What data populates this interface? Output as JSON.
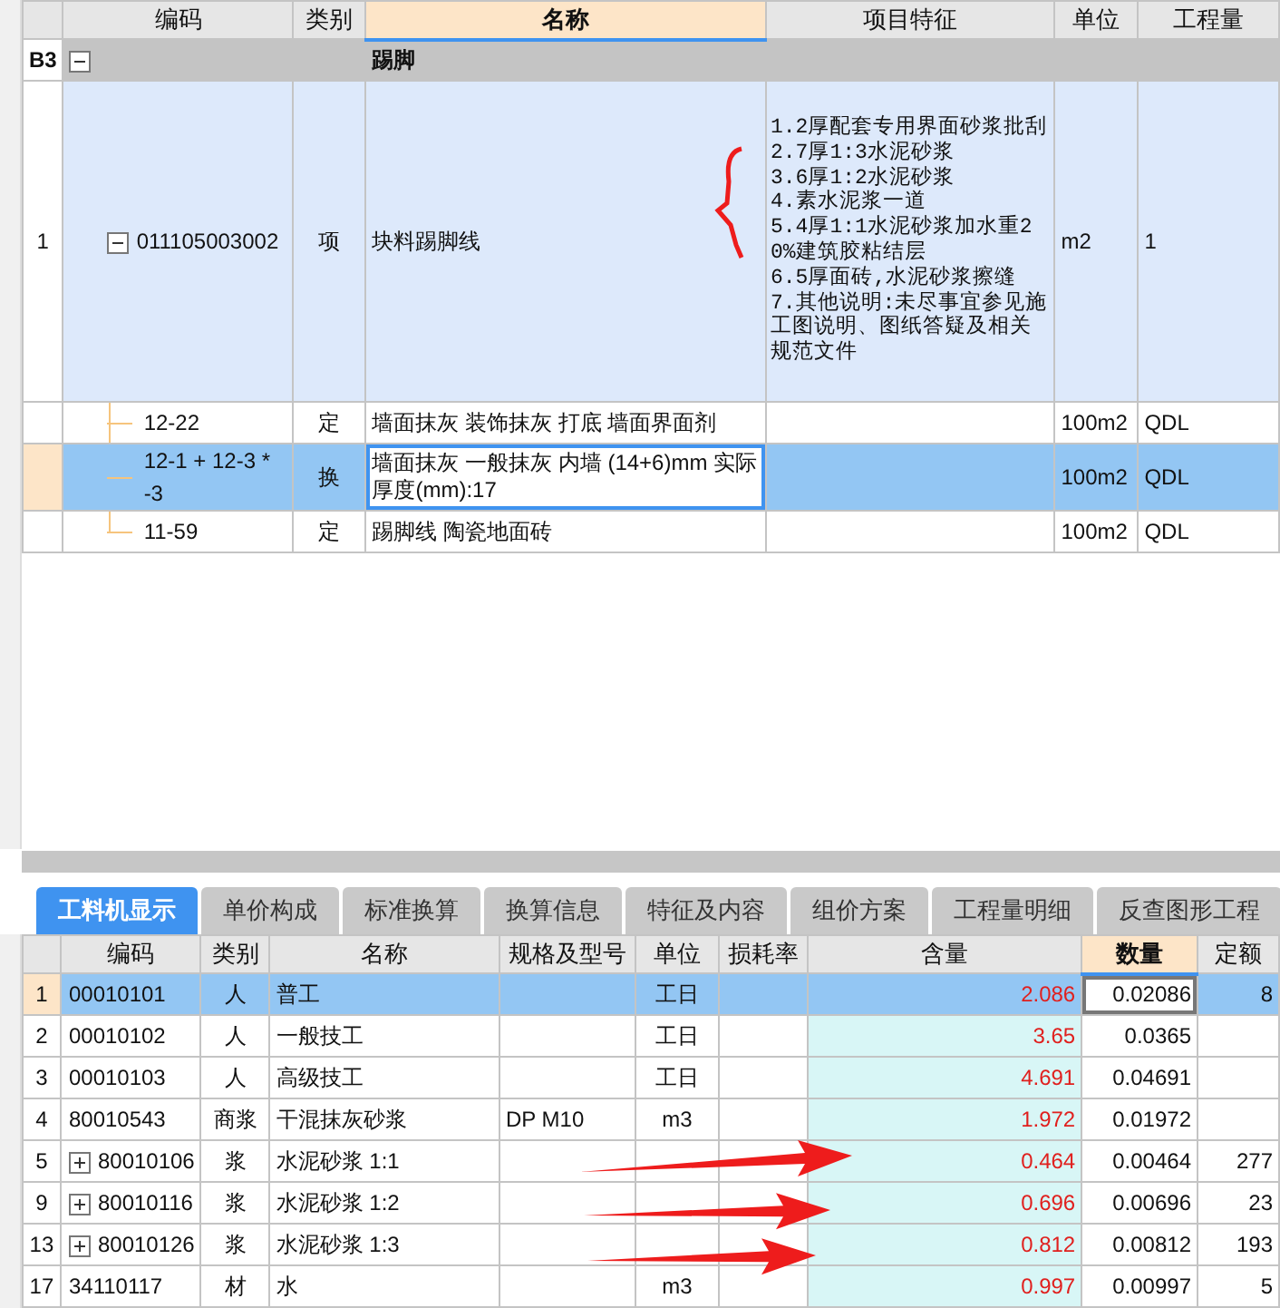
{
  "top_grid": {
    "columns": [
      {
        "label": "编码",
        "sorted": false
      },
      {
        "label": "类别",
        "sorted": false
      },
      {
        "label": "名称",
        "sorted": true
      },
      {
        "label": "项目特征",
        "sorted": false
      },
      {
        "label": "单位",
        "sorted": false
      },
      {
        "label": "工程量",
        "sorted": false
      }
    ],
    "section": {
      "row_label": "B3",
      "expanded": true,
      "name": "踢脚"
    },
    "rows": [
      {
        "kind": "item",
        "row_label": "1",
        "expanded": true,
        "selected": false,
        "code": "011105003002",
        "type": "项",
        "name": "块料踢脚线",
        "feature": [
          "1.2厚配套专用界面砂浆批刮",
          "2.7厚1:3水泥砂浆",
          "3.6厚1:2水泥砂浆",
          "4.素水泥浆一道",
          "5.4厚1:1水泥砂浆加水重20%建筑胶粘结层",
          "6.5厚面砖,水泥砂浆擦缝",
          "7.其他说明:未尽事宜参见施工图说明、图纸答疑及相关规范文件"
        ],
        "unit": "m2",
        "quantity": "1"
      },
      {
        "kind": "sub",
        "selected": false,
        "code": "12-22",
        "type": "定",
        "name": "墙面抹灰 装饰抹灰 打底 墙面界面剂",
        "unit": "100m2",
        "quantity": "QDL"
      },
      {
        "kind": "sub",
        "selected": true,
        "code": "12-1 + 12-3 * -3",
        "type": "换",
        "name": "墙面抹灰 一般抹灰 内墙 (14+6)mm 实际厚度(mm):17",
        "unit": "100m2",
        "quantity": "QDL"
      },
      {
        "kind": "sub",
        "selected": false,
        "code": "11-59",
        "type": "定",
        "name": "踢脚线 陶瓷地面砖",
        "unit": "100m2",
        "quantity": "QDL"
      }
    ]
  },
  "tabs": [
    {
      "label": "工料机显示",
      "selected": true
    },
    {
      "label": "单价构成",
      "selected": false
    },
    {
      "label": "标准换算",
      "selected": false
    },
    {
      "label": "换算信息",
      "selected": false
    },
    {
      "label": "特征及内容",
      "selected": false
    },
    {
      "label": "组价方案",
      "selected": false
    },
    {
      "label": "工程量明细",
      "selected": false
    },
    {
      "label": "反查图形工程",
      "selected": false
    }
  ],
  "resource_table": {
    "columns": [
      {
        "label": "编码",
        "sorted": false
      },
      {
        "label": "类别",
        "sorted": false
      },
      {
        "label": "名称",
        "sorted": false
      },
      {
        "label": "规格及型号",
        "sorted": false
      },
      {
        "label": "单位",
        "sorted": false
      },
      {
        "label": "损耗率",
        "sorted": false
      },
      {
        "label": "含量",
        "sorted": false
      },
      {
        "label": "数量",
        "sorted": true
      },
      {
        "label": "定额",
        "sorted": false
      }
    ],
    "rows": [
      {
        "row_label": "1",
        "selected": true,
        "expandable": false,
        "code": "00010101",
        "type": "人",
        "name": "普工",
        "unit": "工日",
        "content": "2.086",
        "amount": "0.02086",
        "price": "8"
      },
      {
        "row_label": "2",
        "selected": false,
        "expandable": false,
        "code": "00010102",
        "type": "人",
        "name": "一般技工",
        "unit": "工日",
        "content": "3.65",
        "amount": "0.0365"
      },
      {
        "row_label": "3",
        "selected": false,
        "expandable": false,
        "code": "00010103",
        "type": "人",
        "name": "高级技工",
        "unit": "工日",
        "content": "4.691",
        "amount": "0.04691"
      },
      {
        "row_label": "4",
        "selected": false,
        "expandable": false,
        "code": "80010543",
        "type": "商浆",
        "name": "干混抹灰砂浆",
        "spec": "DP M10",
        "unit": "m3",
        "content": "1.972",
        "amount": "0.01972"
      },
      {
        "row_label": "5",
        "selected": false,
        "expandable": true,
        "code": "80010106",
        "type": "浆",
        "name": "水泥砂浆 1:1",
        "content": "0.464",
        "amount": "0.00464",
        "price": "277"
      },
      {
        "row_label": "9",
        "selected": false,
        "expandable": true,
        "code": "80010116",
        "type": "浆",
        "name": "水泥砂浆 1:2",
        "content": "0.696",
        "amount": "0.00696",
        "price": "23"
      },
      {
        "row_label": "13",
        "selected": false,
        "expandable": true,
        "code": "80010126",
        "type": "浆",
        "name": "水泥砂浆 1:3",
        "content": "0.812",
        "amount": "0.00812",
        "price": "193"
      },
      {
        "row_label": "17",
        "selected": false,
        "expandable": false,
        "code": "34110117",
        "type": "材",
        "name": "水",
        "unit": "m3",
        "content": "0.997",
        "amount": "0.00997",
        "price": "5"
      }
    ]
  },
  "annotations": [
    {
      "kind": "brace"
    },
    {
      "kind": "arrow"
    },
    {
      "kind": "arrow"
    },
    {
      "kind": "arrow"
    }
  ]
}
